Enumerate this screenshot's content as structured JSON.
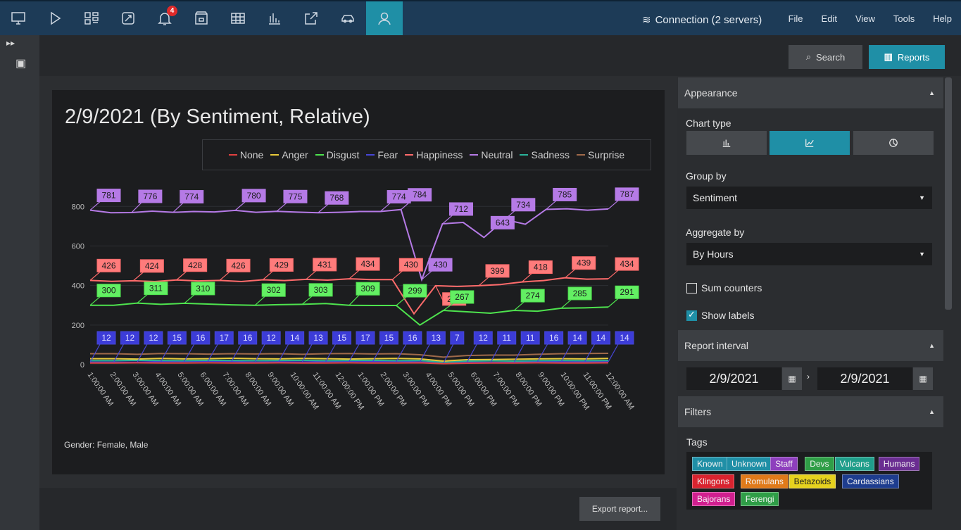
{
  "topbar": {
    "icons": [
      "monitor-icon",
      "play-icon",
      "layout-icon",
      "tracking-icon",
      "alarm-bell-icon",
      "archive-icon",
      "grid-icon",
      "bar-chart-icon",
      "export-icon",
      "car-icon",
      "face-user-icon"
    ],
    "alarm_count": "4",
    "connection_label": "Connection (2 servers)",
    "menu": [
      "File",
      "Edit",
      "View",
      "Tools",
      "Help"
    ]
  },
  "subbar": {
    "search_label": "Search",
    "reports_label": "Reports"
  },
  "chart_data": {
    "type": "line",
    "title": "2/9/2021 (By Sentiment, Relative)",
    "x": [
      "1:00:00 AM",
      "2:00:00 AM",
      "3:00:00 AM",
      "4:00:00 AM",
      "5:00:00 AM",
      "6:00:00 AM",
      "7:00:00 AM",
      "8:00:00 AM",
      "9:00:00 AM",
      "10:00:00 AM",
      "11:00:00 AM",
      "12:00:00 PM",
      "1:00:00 PM",
      "2:00:00 PM",
      "3:00:00 PM",
      "4:00:00 PM",
      "5:00:00 PM",
      "6:00:00 PM",
      "7:00:00 PM",
      "8:00:00 PM",
      "9:00:00 PM",
      "10:00:00 PM",
      "11:00:00 PM",
      "12:00:00 AM"
    ],
    "y_ticks": [
      "0",
      "200",
      "400",
      "600",
      "800"
    ],
    "ylim": [
      0,
      900
    ],
    "legend": [
      "None",
      "Anger",
      "Disgust",
      "Fear",
      "Happiness",
      "Neutral",
      "Sadness",
      "Surprise"
    ],
    "legend_position": "top-right",
    "series": [
      {
        "name": "Neutral",
        "color": "#b57ae6",
        "label_bg": "#b57ae6",
        "values": [
          781,
          768,
          769,
          776,
          770,
          774,
          772,
          780,
          770,
          775,
          771,
          768,
          770,
          774,
          774,
          784,
          430,
          712,
          719,
          643,
          734,
          710,
          785,
          788,
          781,
          787
        ],
        "labels": [
          "781",
          "776",
          "774",
          "780",
          "775",
          "768",
          "774",
          "784",
          "430",
          "712",
          "643",
          "734",
          "785",
          "787"
        ],
        "label_idx": [
          0,
          2,
          4,
          7,
          9,
          11,
          14,
          15,
          16,
          17,
          19,
          20,
          22,
          25
        ]
      },
      {
        "name": "Happiness",
        "color": "#ff6b6b",
        "values": [
          426,
          421,
          424,
          420,
          428,
          423,
          426,
          420,
          429,
          425,
          431,
          427,
          434,
          430,
          430,
          257,
          399,
          395,
          399,
          405,
          418,
          425,
          439,
          432,
          434
        ],
        "labels": [
          "426",
          "424",
          "428",
          "426",
          "429",
          "431",
          "434",
          "430",
          "257",
          "399",
          "418",
          "439",
          "434"
        ]
      },
      {
        "name": "Disgust",
        "color": "#4ee34e",
        "values": [
          300,
          300,
          311,
          305,
          310,
          306,
          302,
          300,
          303,
          305,
          309,
          300,
          299,
          299,
          200,
          274,
          267,
          260,
          274,
          270,
          285,
          287,
          291
        ],
        "labels": [
          "300",
          "311",
          "310",
          "302",
          "303",
          "309",
          "299",
          "267",
          "274",
          "285",
          "291"
        ]
      },
      {
        "name": "Fear",
        "color": "#4646d6",
        "values": [
          12,
          12,
          12,
          15,
          16,
          17,
          16,
          12,
          14,
          13,
          15,
          17,
          15,
          16,
          13,
          7,
          12,
          11,
          11,
          16,
          14,
          14,
          14
        ],
        "labels": [
          "12",
          "12",
          "12",
          "15",
          "16",
          "17",
          "16",
          "12",
          "14",
          "13",
          "15",
          "17",
          "15",
          "16",
          "13",
          "7",
          "12",
          "11",
          "11",
          "16",
          "14",
          "14",
          "14"
        ]
      },
      {
        "name": "Surprise",
        "color": "#a06a4a",
        "values": [
          55,
          55,
          52,
          56,
          55,
          53,
          55,
          54,
          55,
          52,
          55,
          56,
          54,
          55,
          50,
          38,
          46,
          48,
          48,
          52,
          55,
          56,
          57
        ]
      },
      {
        "name": "Sadness",
        "color": "#2ab39a",
        "values": [
          20,
          20,
          22,
          21,
          20,
          22,
          21,
          20,
          21,
          22,
          20,
          21,
          22,
          20,
          21,
          12,
          18,
          19,
          18,
          20,
          21,
          20,
          21
        ]
      },
      {
        "name": "Anger",
        "color": "#e8c93a",
        "values": [
          30,
          30,
          28,
          31,
          29,
          30,
          32,
          30,
          29,
          31,
          30,
          28,
          30,
          31,
          29,
          18,
          25,
          26,
          27,
          29,
          30,
          29,
          31
        ]
      },
      {
        "name": "None",
        "color": "#e04040",
        "values": [
          8,
          8,
          9,
          8,
          8,
          9,
          8,
          8,
          9,
          8,
          8,
          9,
          8,
          8,
          9,
          5,
          7,
          8,
          8,
          9,
          8,
          8,
          9
        ]
      }
    ],
    "note": "Gender: Female, Male"
  },
  "bottom": {
    "export_label": "Export report..."
  },
  "panel": {
    "appearance_title": "Appearance",
    "chart_type_label": "Chart type",
    "chart_types": [
      "bar-chart-type-icon",
      "line-chart-type-icon",
      "pie-chart-type-icon"
    ],
    "group_by_label": "Group by",
    "group_by_value": "Sentiment",
    "aggregate_by_label": "Aggregate by",
    "aggregate_by_value": "By Hours",
    "sum_counters_label": "Sum counters",
    "show_labels_label": "Show labels",
    "interval_title": "Report interval",
    "date_from": "2/9/2021",
    "date_to": "2/9/2021",
    "filters_title": "Filters",
    "tags_label": "Tags",
    "tags": [
      {
        "name": "Known",
        "color": "#1f8fa6"
      },
      {
        "name": "Unknown",
        "color": "#1f8fa6"
      },
      {
        "name": "Staff",
        "color": "#8e3fbd"
      },
      {
        "name": "Devs",
        "color": "#2f9e47"
      },
      {
        "name": "Vulcans",
        "color": "#1f9e8a"
      },
      {
        "name": "Humans",
        "color": "#6a2d91"
      },
      {
        "name": "Klingons",
        "color": "#d9232f"
      },
      {
        "name": "Romulans",
        "color": "#e07a1a"
      },
      {
        "name": "Betazoids",
        "color": "#e6d21e"
      },
      {
        "name": "Cardassians",
        "color": "#1e3d8f"
      },
      {
        "name": "Bajorans",
        "color": "#d11f8f"
      },
      {
        "name": "Ferengi",
        "color": "#2f9e47"
      }
    ]
  }
}
